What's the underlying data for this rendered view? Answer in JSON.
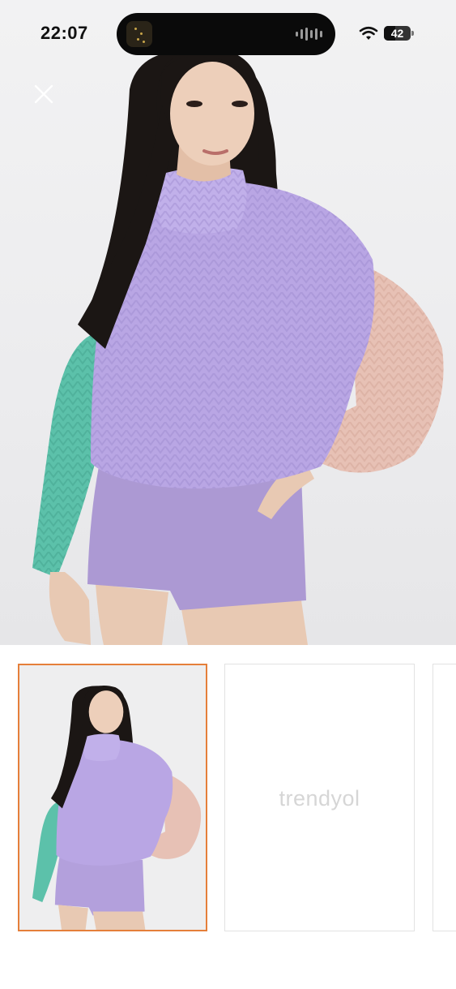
{
  "status_bar": {
    "time": "22:07",
    "battery_level": "42",
    "wifi_icon": "wifi-icon",
    "island_icon": "now-playing-waveform-icon"
  },
  "product_viewer": {
    "close_icon": "close-icon",
    "hero_image": "model wearing color-block knit sweater and lilac shorts",
    "thumbnails": [
      {
        "type": "image",
        "selected": true
      },
      {
        "type": "placeholder",
        "selected": false,
        "brand_text": "trendyol"
      },
      {
        "type": "image",
        "selected": false
      }
    ]
  },
  "colors": {
    "selected_border": "#e57f3a",
    "sweater": "#b9a6e4",
    "sleeve_left": "#5cc1aa",
    "sleeve_right": "#e7c1b5",
    "shorts": "#b3a0dc"
  }
}
